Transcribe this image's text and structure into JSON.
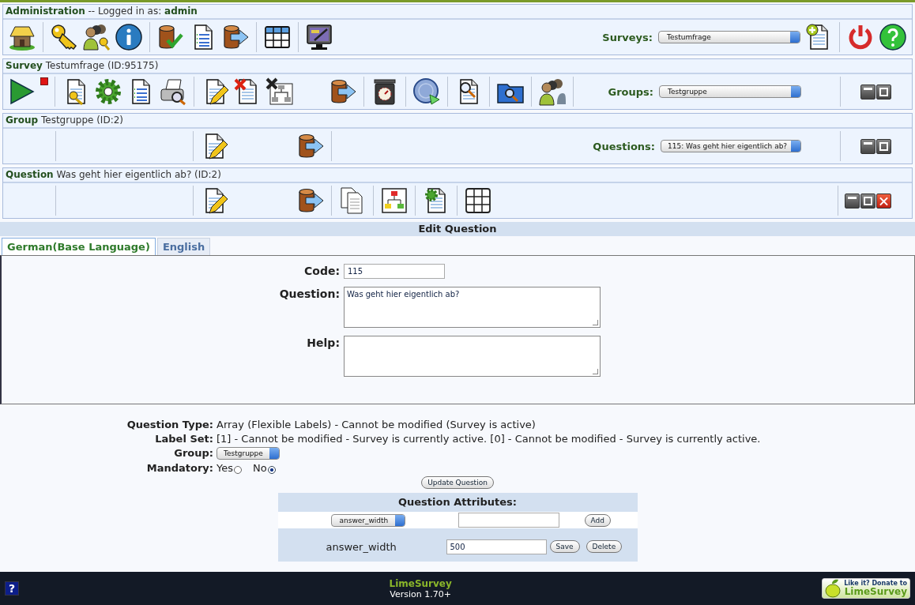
{
  "admin": {
    "header": "**Administration** -- Logged in as: **admin**",
    "select_label": "Surveys:",
    "select_value": "Testumfrage"
  },
  "survey": {
    "header": "**Survey** Testumfrage (ID:95175)",
    "select_label": "Groups:",
    "select_value": "Testgruppe"
  },
  "group": {
    "header": "**Group** Testgruppe (ID:2)",
    "select_label": "Questions:",
    "select_value": "115: Was geht hier eigentlich ab?"
  },
  "question": {
    "header": "**Question** Was geht hier eigentlich ab? (ID:2)"
  },
  "edit": {
    "title": "Edit Question",
    "tabs": [
      {
        "label": "German(Base Language)",
        "selected": true
      },
      {
        "label": "English",
        "selected": false
      }
    ],
    "fields": [
      {
        "label": "Code:",
        "kind": "input",
        "value": "115"
      },
      {
        "label": "Question:",
        "kind": "textarea",
        "value": "Was geht hier eigentlich ab?"
      },
      {
        "label": "Help:",
        "kind": "textarea"
      }
    ]
  },
  "details": [
    {
      "label": "Question Type:",
      "kind": "text",
      "value": "Array (Flexible Labels) - Cannot be modified (Survey is active)"
    },
    {
      "label": "Label Set:",
      "kind": "text",
      "value": "[1] - Cannot be modified - Survey is currently active. [0] - Cannot be modified - Survey is currently active."
    },
    {
      "label": "Group:",
      "kind": "select",
      "value": "Testgruppe"
    },
    {
      "label": "Mandatory:",
      "kind": "radio",
      "options": [
        {
          "label": "Yes",
          "selected": false
        },
        {
          "label": "No",
          "selected": true
        }
      ]
    }
  ],
  "update_button": "Update Question",
  "attributes": {
    "title": "Question Attributes:",
    "new_select": "answer_width",
    "add_button": "Add",
    "rows": [
      {
        "name": "answer_width",
        "value": "500",
        "save_button": "Save",
        "delete_button": "Delete"
      }
    ]
  },
  "footer": {
    "help": "?",
    "name": "LimeSurvey",
    "version": "Version 1.70+",
    "donate_top": "Like it? Donate to",
    "donate_bottom": "LimeSurvey"
  }
}
